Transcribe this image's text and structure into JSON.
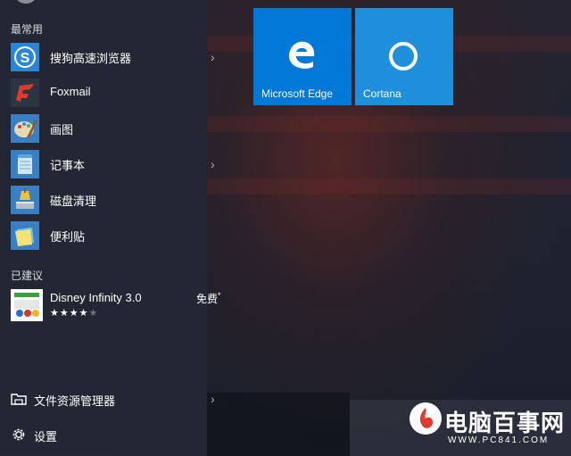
{
  "sections": {
    "frequent": "最常用",
    "suggested": "已建议"
  },
  "apps": [
    {
      "label": "搜狗高速浏览器",
      "icon": "sogou-browser-icon",
      "has_submenu": true
    },
    {
      "label": "Foxmail",
      "icon": "foxmail-icon",
      "has_submenu": false
    },
    {
      "label": "画图",
      "icon": "paint-icon",
      "has_submenu": false
    },
    {
      "label": "记事本",
      "icon": "notepad-icon",
      "has_submenu": true
    },
    {
      "label": "磁盘清理",
      "icon": "disk-cleanup-icon",
      "has_submenu": false
    },
    {
      "label": "便利贴",
      "icon": "sticky-notes-icon",
      "has_submenu": false
    }
  ],
  "suggestion": {
    "title": "Disney Infinity 3.0",
    "rating_stars": 4,
    "rating_max": 5,
    "price": "免费",
    "price_mark": "*"
  },
  "bottom": {
    "explorer": "文件资源管理器",
    "settings": "设置"
  },
  "tiles": [
    {
      "label": "Microsoft Edge",
      "icon": "edge-icon",
      "color": "#0078d7"
    },
    {
      "label": "Cortana",
      "icon": "cortana-icon",
      "color": "#1e8fdb"
    }
  ],
  "watermark": {
    "text": "电脑百事网",
    "url": "WWW.PC841.COM"
  },
  "colors": {
    "menu_bg": "#222834",
    "accent": "#0078d7"
  }
}
